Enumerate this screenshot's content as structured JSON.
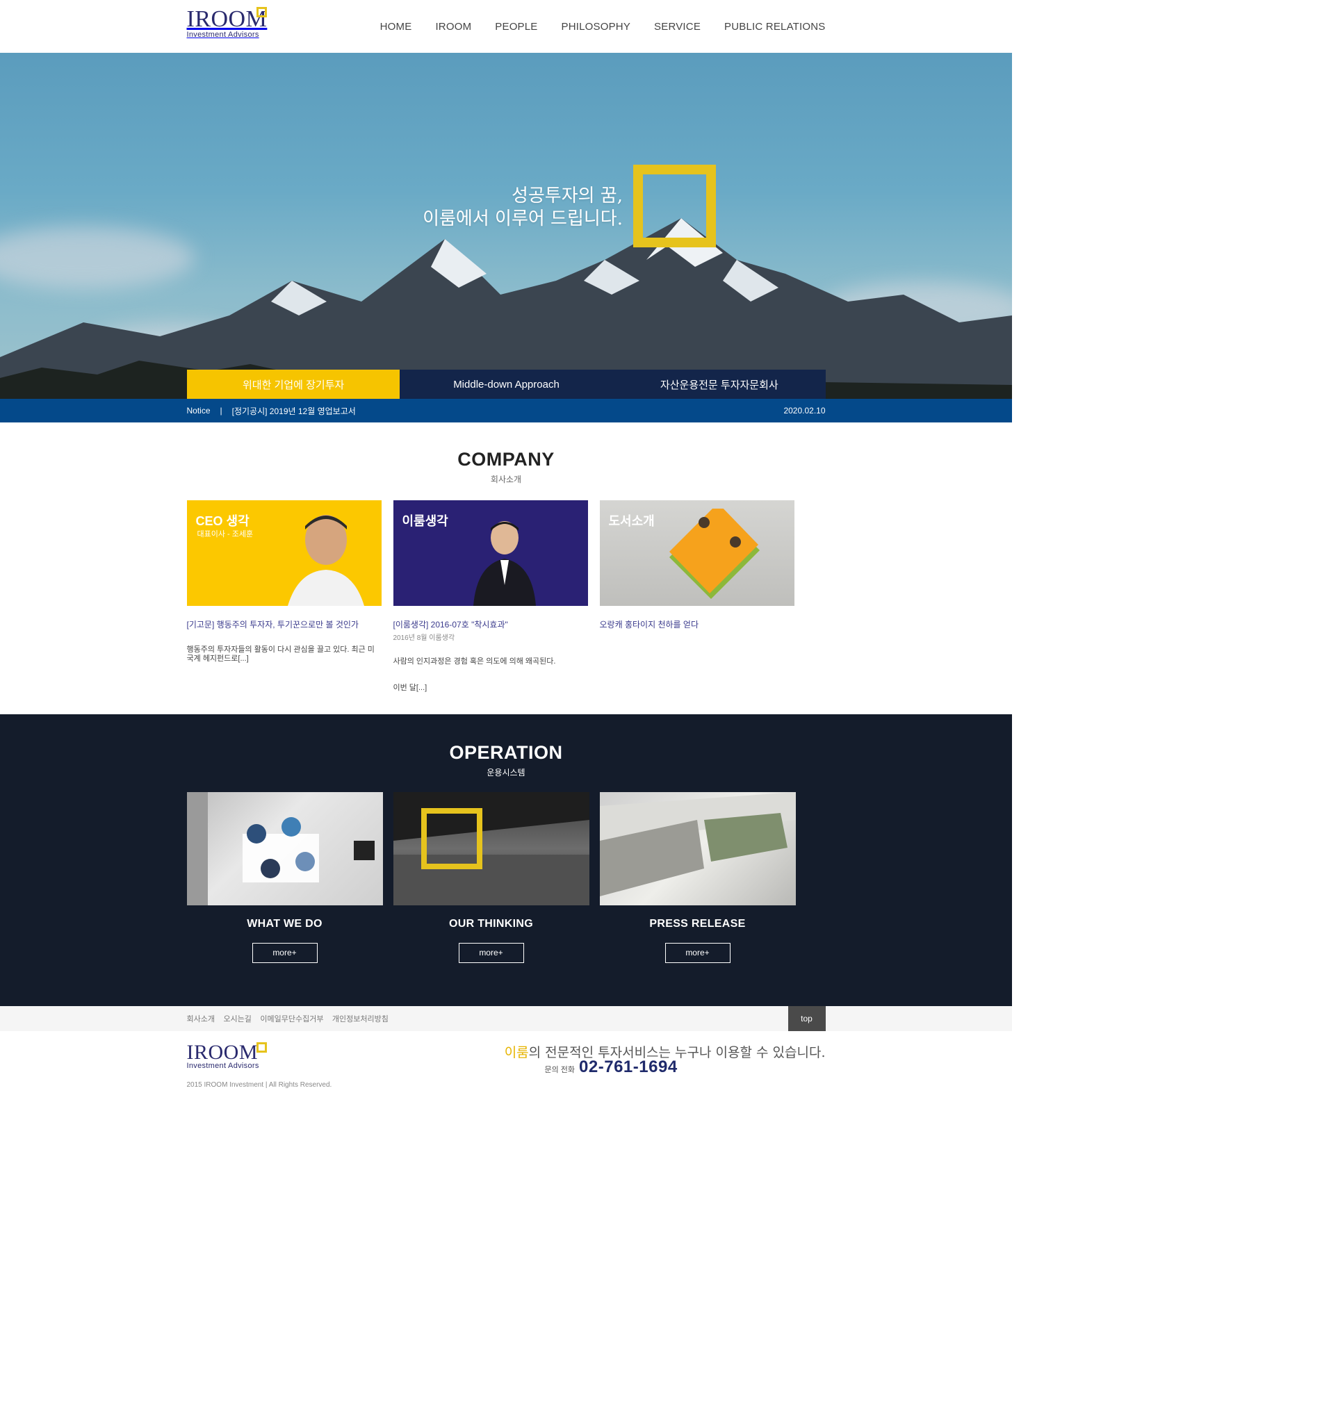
{
  "header": {
    "logo_text": "IROOM",
    "logo_sub": "Investment Advisors",
    "nav": [
      "HOME",
      "IROOM",
      "PEOPLE",
      "PHILOSOPHY",
      "SERVICE",
      "PUBLIC RELATIONS"
    ]
  },
  "hero": {
    "line1": "성공투자의 꿈,",
    "line2": "이룸에서 이루어 드립니다.",
    "tabs": [
      "위대한 기업에 장기투자",
      "Middle-down Approach",
      "자산운용전문 투자자문회사"
    ]
  },
  "notice": {
    "label": "Notice",
    "separator": "|",
    "text": "[정기공시] 2019년 12월 영업보고서",
    "date": "2020.02.10"
  },
  "company": {
    "title": "COMPANY",
    "subtitle": "회사소개",
    "cards": [
      {
        "title": "CEO 생각",
        "subtitle": "대표이사 - 조세훈",
        "link": "[기고문] 행동주의 투자자, 투기꾼으로만 볼 것인가",
        "desc": "행동주의 투자자들의 활동이 다시 관심을 끌고 있다. 최근 미국계 헤지펀드로[...]"
      },
      {
        "title": "이룸생각",
        "link": "[이룸생각] 2016-07호 \"착시효과\"",
        "meta": "2016년 8월 이룸생각",
        "desc": "사람의 인지과정은 경험 혹은 의도에 의해 왜곡된다.",
        "more": "이번 달[...]"
      },
      {
        "title": "도서소개",
        "link": "오랑캐 홍타이지 천하를 얻다"
      }
    ]
  },
  "operation": {
    "title": "OPERATION",
    "subtitle": "운용시스템",
    "items": [
      {
        "title": "WHAT WE DO",
        "button": "more+"
      },
      {
        "title": "OUR THINKING",
        "button": "more+"
      },
      {
        "title": "PRESS RELEASE",
        "button": "more+"
      }
    ]
  },
  "footer": {
    "links": [
      "회사소개",
      "오시는길",
      "이메일무단수집거부",
      "개인정보처리방침"
    ],
    "top": "top",
    "logo_text": "IROOM",
    "logo_sub": "Investment Advisors",
    "copyright": "2015 IROOM Investment | All Rights Reserved.",
    "slogan_highlight": "이룸",
    "slogan_rest": "의 전문적인 투자서비스는 누구나 이용할 수 있습니다.",
    "phone_label": "문의 전화",
    "phone": "02-761-1694"
  },
  "colors": {
    "accent_yellow": "#f6c400",
    "navy": "#13254a",
    "notice_blue": "#04498a",
    "operation_bg": "#141c2b",
    "logo_blue": "#2a2a6e"
  }
}
